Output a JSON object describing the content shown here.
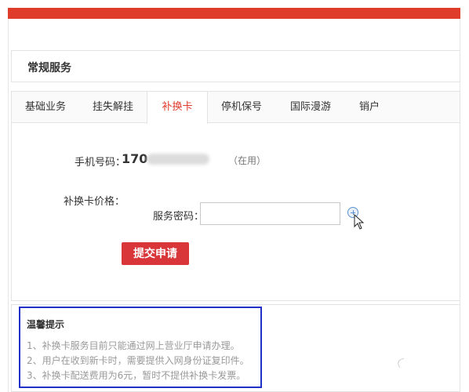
{
  "section": {
    "title": "常规服务"
  },
  "tabs": [
    {
      "label": "基础业务"
    },
    {
      "label": "挂失解挂"
    },
    {
      "label": "补换卡",
      "active": true
    },
    {
      "label": "停机保号"
    },
    {
      "label": "国际漫游"
    },
    {
      "label": "销户"
    }
  ],
  "form": {
    "phone_label": "手机号码：",
    "phone_prefix": "170",
    "phone_status": "（在用）",
    "price_label": "补换卡价格：",
    "password_label": "服务密码：",
    "password_value": "",
    "submit_label": "提交申请"
  },
  "tips": {
    "title": "温馨提示",
    "items": [
      "1、补换卡服务目前只能通过网上营业厅申请办理。",
      "2、用户在收到新卡时，需要提供入网身份证复印件。",
      "3、补换卡配送费用为6元，暂时不提供补换卡发票。"
    ]
  },
  "colors": {
    "accent_red": "#e03c2c",
    "button_red": "#d9363a",
    "highlight_blue": "#2030c8"
  },
  "icons": {
    "password_help": "plus-circle-icon",
    "pointer": "mouse-cursor-icon"
  }
}
